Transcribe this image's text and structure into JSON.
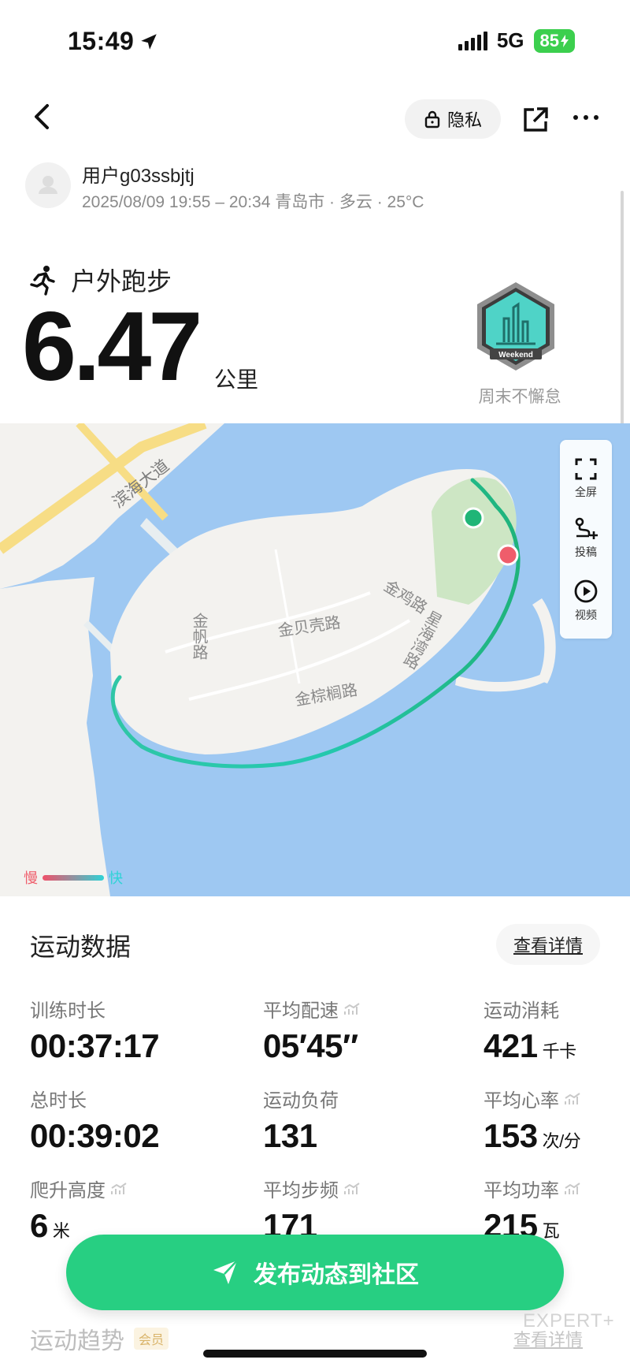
{
  "status_bar": {
    "time": "15:49",
    "network": "5G",
    "battery": "85"
  },
  "header": {
    "privacy_label": "隐私"
  },
  "user": {
    "name": "用户g03ssbjtj",
    "meta": "2025/08/09 19:55 – 20:34 青岛市 · 多云 · 25°C"
  },
  "workout": {
    "sport": "户外跑步",
    "distance": "6.47",
    "distance_unit": "公里",
    "badge_label": "周末不懈怠",
    "badge_text": "Weekend"
  },
  "map": {
    "labels": {
      "road1": "滨海大道",
      "road2": "金帆路",
      "road3": "金贝壳路",
      "road4": "金鸡路",
      "road5": "金棕榈路",
      "road6": "星海湾路"
    },
    "tools": {
      "fullscreen": "全屏",
      "post": "投稿",
      "video": "视频"
    },
    "legend": {
      "slow": "慢",
      "fast": "快"
    },
    "colors": {
      "water": "#9ec8f2",
      "land": "#f3f2ef",
      "park": "#cde6c4",
      "route_start": "#20b577",
      "route_end": "#ef5d6b"
    }
  },
  "stats": {
    "title": "运动数据",
    "detail_label": "查看详情",
    "items": [
      {
        "label": "训练时长",
        "value": "00:37:17",
        "unit": "",
        "chart_icon": false
      },
      {
        "label": "平均配速",
        "value": "05′45″",
        "unit": "",
        "chart_icon": true
      },
      {
        "label": "运动消耗",
        "value": "421",
        "unit": "千卡",
        "chart_icon": false
      },
      {
        "label": "总时长",
        "value": "00:39:02",
        "unit": "",
        "chart_icon": false
      },
      {
        "label": "运动负荷",
        "value": "131",
        "unit": "",
        "chart_icon": false
      },
      {
        "label": "平均心率",
        "value": "153",
        "unit": "次/分",
        "chart_icon": true
      },
      {
        "label": "爬升高度",
        "value": "6",
        "unit": "米",
        "chart_icon": true
      },
      {
        "label": "平均步频",
        "value": "171",
        "unit": "",
        "chart_icon": true
      },
      {
        "label": "平均功率",
        "value": "215",
        "unit": "瓦",
        "chart_icon": true
      }
    ]
  },
  "publish": {
    "label": "发布动态到社区"
  },
  "trend": {
    "title": "运动趋势",
    "tag": "会员",
    "detail_label": "查看详情"
  },
  "watermark": "EXPERT+"
}
